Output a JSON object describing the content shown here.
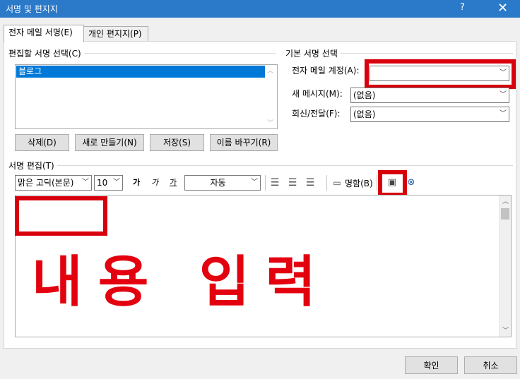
{
  "window": {
    "title": "서명 및 편지지",
    "help": "?",
    "close": "✕"
  },
  "tabs": [
    {
      "label": "전자 메일 서명(E)",
      "active": true
    },
    {
      "label": "개인 편지지(P)",
      "active": false
    }
  ],
  "select_signature": {
    "group_label": "편집할 서명 선택(C)",
    "items": [
      "블로그"
    ],
    "selected": "블로그",
    "buttons": {
      "delete": "삭제(D)",
      "new": "새로 만들기(N)",
      "save": "저장(S)",
      "rename": "이름 바꾸기(R)"
    }
  },
  "default_signature": {
    "group_label": "기본 서명 선택",
    "email_account_label": "전자 메일 계정(A):",
    "email_account_value": "",
    "new_messages_label": "새 메시지(M):",
    "new_messages_value": "(없음)",
    "replies_label": "회신/전달(F):",
    "replies_value": "(없음)"
  },
  "edit_signature": {
    "group_label": "서명 편집(T)",
    "font": "맑은 고딕(본문)",
    "size": "10",
    "bold": "가",
    "italic": "가",
    "underline": "가",
    "color": "자동",
    "business_card": "명함(B)",
    "annotation_text": "내용 입력"
  },
  "footer": {
    "ok": "확인",
    "cancel": "취소"
  },
  "colors": {
    "titlebar": "#2b79c9",
    "selection": "#0078d7",
    "annotation_red": "#e3000f"
  }
}
